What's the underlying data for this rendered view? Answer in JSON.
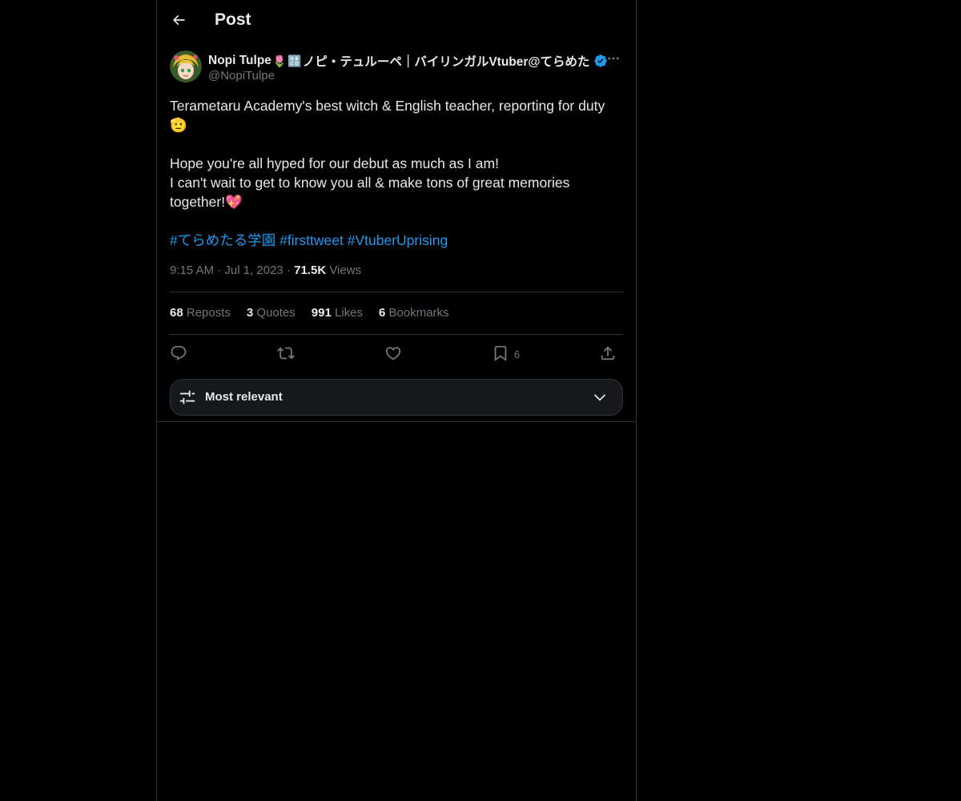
{
  "header": {
    "back_icon": "arrow-left-icon",
    "title": "Post"
  },
  "post": {
    "author": {
      "name_part1": "Nopi Tulpe",
      "emoji_tulip": "🌷",
      "emoji_abcd": "🔠",
      "name_part2": "ノピ・テュルーペ｜バイリンガルVtuber@てらめた",
      "verified_icon": "verified-badge-icon",
      "handle": "@NopiTulpe"
    },
    "text": {
      "line1": "Terametaru Academy's best witch & English teacher, reporting for duty",
      "line1_emoji": "🫡",
      "line2": "Hope you're all hyped for our debut as much as I am!",
      "line3": "I can't wait to get to know you all & make tons of great memories together!",
      "line3_emoji": "💖",
      "hashtags": [
        "#てらめたる学園",
        "#firsttweet",
        "#VtuberUprising"
      ]
    },
    "meta": {
      "time": "9:15 AM",
      "date": "Jul 1, 2023",
      "views_count": "71.5K",
      "views_label": "Views"
    },
    "stats": {
      "reposts_count": "68",
      "reposts_label": "Reposts",
      "quotes_count": "3",
      "quotes_label": "Quotes",
      "likes_count": "991",
      "likes_label": "Likes",
      "bookmarks_count": "6",
      "bookmarks_label": "Bookmarks"
    },
    "actions": {
      "reply_icon": "reply-icon",
      "repost_icon": "repost-icon",
      "like_icon": "heart-icon",
      "bookmark_icon": "bookmark-icon",
      "bookmark_count": "6",
      "share_icon": "share-icon"
    }
  },
  "sort": {
    "label": "Most relevant",
    "icon": "sliders-icon",
    "chevron": "chevron-down-icon"
  },
  "colors": {
    "background": "#000000",
    "text_primary": "#e7e9ea",
    "text_secondary": "#71767b",
    "accent": "#1d9bf0",
    "border": "#2f3336"
  }
}
